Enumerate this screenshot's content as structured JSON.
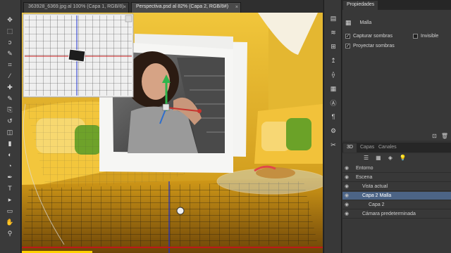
{
  "tabs": [
    {
      "label": "363928_6369.jpg al 100% (Capa 1, RGB/8)",
      "close": "×"
    },
    {
      "label": "Perspectiva.psd al 82% (Capa 2, RGB/8#)",
      "close": "×"
    }
  ],
  "tools": [
    "move-tool",
    "marquee-tool",
    "lasso-tool",
    "quick-select-tool",
    "crop-tool",
    "eyedropper-tool",
    "healing-brush-tool",
    "brush-tool",
    "clone-stamp-tool",
    "history-brush-tool",
    "eraser-tool",
    "gradient-tool",
    "blur-tool",
    "dodge-tool",
    "pen-tool",
    "type-tool",
    "path-select-tool",
    "rectangle-tool",
    "hand-tool",
    "zoom-tool"
  ],
  "tool_glyphs": [
    "✥",
    "⬚",
    "ↄ",
    "✎",
    "⌗",
    "⁄",
    "✚",
    "✎",
    "⎘",
    "↺",
    "◫",
    "▮",
    "◐",
    "◔",
    "✒",
    "T",
    "▸",
    "▭",
    "✋",
    "⚲"
  ],
  "right_strip_glyphs": [
    "▤",
    "≋",
    "⊞",
    "↥",
    "⟠",
    "▦",
    "Ⓐ",
    "¶",
    "⚙",
    "✂"
  ],
  "properties": {
    "tab_label": "Propiedades",
    "section_title": "Malla",
    "capture_shadows_label": "Capturar sombras",
    "invisible_label": "Invisible",
    "project_shadows_label": "Proyectar sombras",
    "capture_shadows_checked": "✓",
    "project_shadows_checked": "✓"
  },
  "bottom_tabs": [
    "3D",
    "Capas",
    "Canales"
  ],
  "layers_3d": [
    {
      "label": "Entorno",
      "indent": 1
    },
    {
      "label": "Escena",
      "indent": 1
    },
    {
      "label": "Vista actual",
      "indent": 2
    },
    {
      "label": "Capa 2 Malla",
      "indent": 2
    },
    {
      "label": "Capa 2",
      "indent": 3
    },
    {
      "label": "Cámara predeterminada",
      "indent": 2
    }
  ],
  "colors": {
    "accent_selection": "#4c6486",
    "scene_yellow": "#e3b42a",
    "sofa_yellow": "#f2c84a",
    "pillow_green": "#6aa22a"
  }
}
